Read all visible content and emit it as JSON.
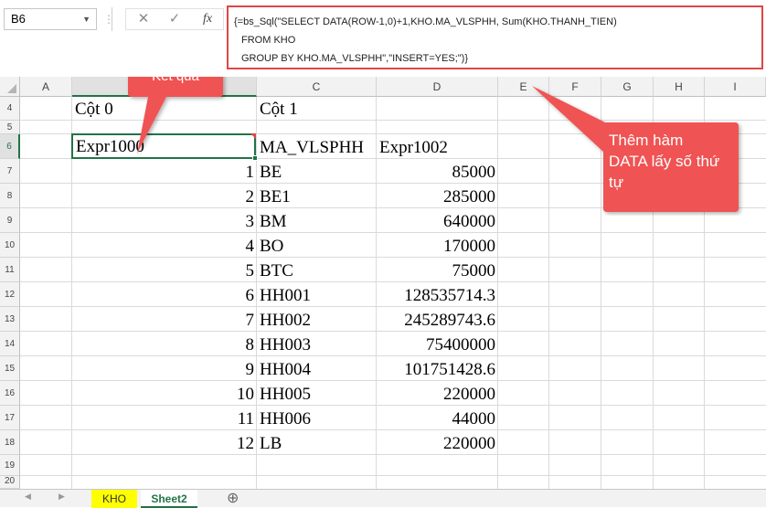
{
  "namebox": {
    "value": "B6"
  },
  "formula_bar": {
    "cancel_icon": "✕",
    "enter_icon": "✓",
    "fx_label": "fx",
    "lines": [
      "{=bs_Sql(\"SELECT DATA(ROW-1,0)+1,KHO.MA_VLSPHH, Sum(KHO.THANH_TIEN)",
      "FROM KHO",
      "GROUP BY KHO.MA_VLSPHH\",\"INSERT=YES;\")}"
    ],
    "border_color": "#e04545"
  },
  "columns": [
    "A",
    "B",
    "C",
    "D",
    "E",
    "F",
    "G",
    "H",
    "I"
  ],
  "row_numbers": [
    "4",
    "5",
    "6",
    "7",
    "8",
    "9",
    "10",
    "11",
    "12",
    "13",
    "14",
    "15",
    "16",
    "17",
    "18",
    "19",
    "20"
  ],
  "header_row4": {
    "b": "Cột 0",
    "c": "Cột 1"
  },
  "header_row6": {
    "b": "Expr1000",
    "c": "MA_VLSPHH",
    "d": "Expr1002"
  },
  "rows": [
    {
      "stt": "1",
      "code": "BE",
      "amount": "85000"
    },
    {
      "stt": "2",
      "code": "BE1",
      "amount": "285000"
    },
    {
      "stt": "3",
      "code": "BM",
      "amount": "640000"
    },
    {
      "stt": "4",
      "code": "BO",
      "amount": "170000"
    },
    {
      "stt": "5",
      "code": "BTC",
      "amount": "75000"
    },
    {
      "stt": "6",
      "code": "HH001",
      "amount": "128535714.3"
    },
    {
      "stt": "7",
      "code": "HH002",
      "amount": "245289743.6"
    },
    {
      "stt": "8",
      "code": "HH003",
      "amount": "75400000"
    },
    {
      "stt": "9",
      "code": "HH004",
      "amount": "101751428.6"
    },
    {
      "stt": "10",
      "code": "HH005",
      "amount": "220000"
    },
    {
      "stt": "11",
      "code": "HH006",
      "amount": "44000"
    },
    {
      "stt": "12",
      "code": "LB",
      "amount": "220000"
    }
  ],
  "callouts": {
    "result": "Kết quả",
    "data_function": "Thêm hàm DATA lấy số thứ tự",
    "color": "#f05252"
  },
  "tabs": {
    "prev_icon": "◀",
    "next_icon": "▶",
    "sheets": [
      {
        "name": "KHO",
        "highlight": "#ffff00"
      },
      {
        "name": "Sheet2",
        "active": true,
        "color": "#217346"
      }
    ],
    "add_icon": "⊕"
  },
  "accent_color": "#217346"
}
